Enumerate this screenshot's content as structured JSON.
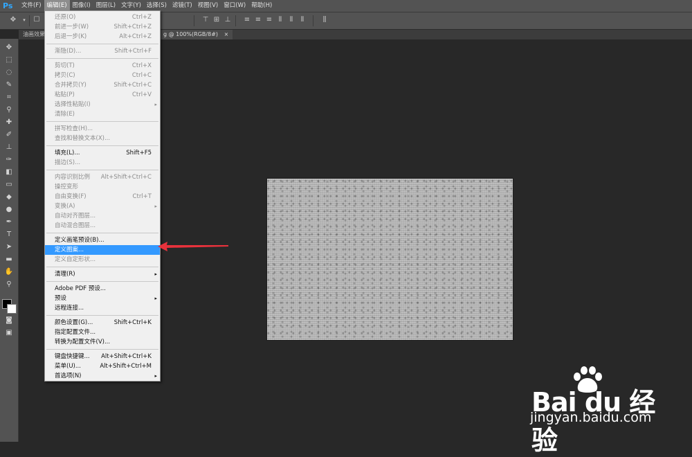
{
  "app": {
    "logo": "Ps"
  },
  "menubar": {
    "items": [
      "文件(F)",
      "编辑(E)",
      "图像(I)",
      "图层(L)",
      "文字(Y)",
      "选择(S)",
      "滤镜(T)",
      "视图(V)",
      "窗口(W)",
      "帮助(H)"
    ],
    "active_index": 1
  },
  "tabs": {
    "tab1": "油画效果",
    "tab2": "g @ 100%(RGB/8#)",
    "close": "×"
  },
  "menu": {
    "rows": [
      {
        "label": "还原(O)",
        "shortcut": "Ctrl+Z"
      },
      {
        "label": "前进一步(W)",
        "shortcut": "Shift+Ctrl+Z"
      },
      {
        "label": "后退一步(K)",
        "shortcut": "Alt+Ctrl+Z"
      },
      {
        "label": "渐隐(D)...",
        "shortcut": "Shift+Ctrl+F"
      },
      {
        "label": "剪切(T)",
        "shortcut": "Ctrl+X"
      },
      {
        "label": "拷贝(C)",
        "shortcut": "Ctrl+C"
      },
      {
        "label": "合并拷贝(Y)",
        "shortcut": "Shift+Ctrl+C"
      },
      {
        "label": "粘贴(P)",
        "shortcut": "Ctrl+V"
      },
      {
        "label": "选择性粘贴(I)",
        "shortcut": ""
      },
      {
        "label": "清除(E)",
        "shortcut": ""
      },
      {
        "label": "拼写检查(H)...",
        "shortcut": ""
      },
      {
        "label": "查找和替换文本(X)...",
        "shortcut": ""
      },
      {
        "label": "填充(L)...",
        "shortcut": "Shift+F5"
      },
      {
        "label": "描边(S)...",
        "shortcut": ""
      },
      {
        "label": "内容识别比例",
        "shortcut": "Alt+Shift+Ctrl+C"
      },
      {
        "label": "操控变形",
        "shortcut": ""
      },
      {
        "label": "自由变换(F)",
        "shortcut": "Ctrl+T"
      },
      {
        "label": "变换(A)",
        "shortcut": ""
      },
      {
        "label": "自动对齐图层...",
        "shortcut": ""
      },
      {
        "label": "自动混合图层...",
        "shortcut": ""
      },
      {
        "label": "定义画笔预设(B)...",
        "shortcut": ""
      },
      {
        "label": "定义图案...",
        "shortcut": ""
      },
      {
        "label": "定义自定形状...",
        "shortcut": ""
      },
      {
        "label": "清理(R)",
        "shortcut": ""
      },
      {
        "label": "Adobe PDF 预设...",
        "shortcut": ""
      },
      {
        "label": "预设",
        "shortcut": ""
      },
      {
        "label": "远程连接...",
        "shortcut": ""
      },
      {
        "label": "颜色设置(G)...",
        "shortcut": "Shift+Ctrl+K"
      },
      {
        "label": "指定配置文件...",
        "shortcut": ""
      },
      {
        "label": "转换为配置文件(V)...",
        "shortcut": ""
      },
      {
        "label": "键盘快捷键...",
        "shortcut": "Alt+Shift+Ctrl+K"
      },
      {
        "label": "菜单(U)...",
        "shortcut": "Alt+Shift+Ctrl+M"
      },
      {
        "label": "首选项(N)",
        "shortcut": ""
      }
    ],
    "submenu_arrow": "▸"
  },
  "watermark": {
    "logo": "Bai du 经验",
    "url": "jingyan.baidu.com"
  },
  "colors": {
    "highlight": "#3399ff",
    "annotation_arrow": "#e8323c",
    "workspace": "#282828",
    "panel": "#535353"
  }
}
